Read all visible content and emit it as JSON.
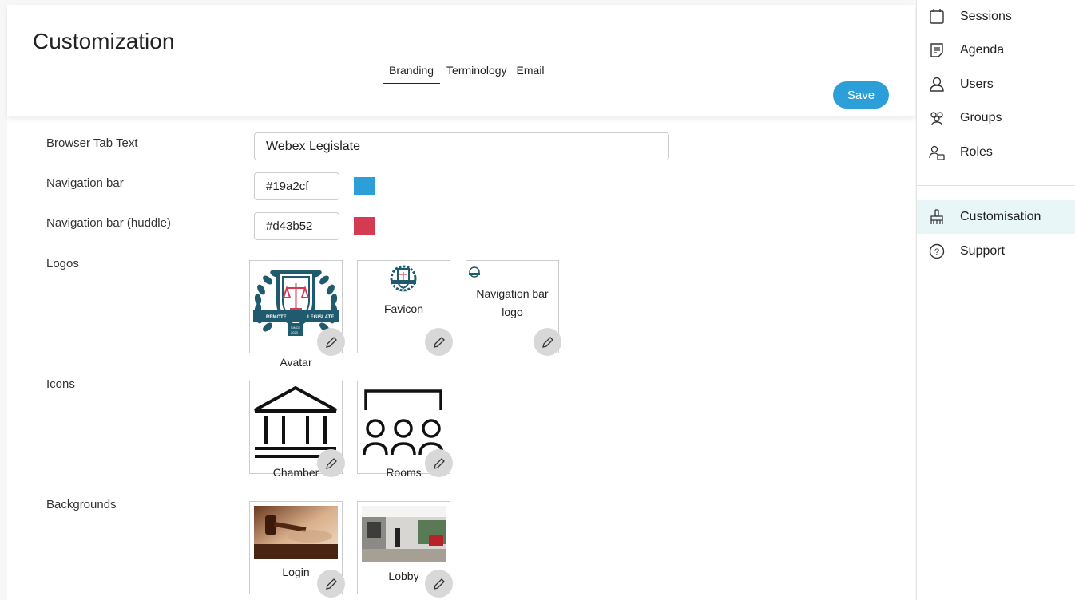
{
  "header": {
    "title": "Customization",
    "tabs": [
      {
        "label": "Branding",
        "active": true
      },
      {
        "label": "Terminology",
        "active": false
      },
      {
        "label": "Email",
        "active": false
      }
    ],
    "save_label": "Save"
  },
  "form": {
    "browser_tab_text": {
      "label": "Browser Tab Text",
      "value": "Webex Legislate"
    },
    "nav_bar": {
      "label": "Navigation bar",
      "value": "#19a2cf",
      "color": "#2d9fd8"
    },
    "nav_bar_huddle": {
      "label": "Navigation bar (huddle)",
      "value": "#d43b52",
      "color": "#d43b52"
    },
    "logos": {
      "label": "Logos",
      "items": [
        {
          "caption": "Avatar",
          "seal_left": "REMOTE",
          "seal_right": "LEGISLATE",
          "seal_since": "SINCE",
          "seal_year": "2020"
        },
        {
          "caption": "Favicon"
        },
        {
          "caption": "Navigation bar logo",
          "caption_line1": "Navigation bar",
          "caption_line2": "logo"
        }
      ]
    },
    "icons": {
      "label": "Icons",
      "items": [
        {
          "caption": "Chamber"
        },
        {
          "caption": "Rooms"
        }
      ]
    },
    "backgrounds": {
      "label": "Backgrounds",
      "items": [
        {
          "caption": "Login"
        },
        {
          "caption": "Lobby"
        }
      ]
    }
  },
  "sidebar": {
    "items": [
      {
        "label": "Sessions",
        "icon": "calendar-icon"
      },
      {
        "label": "Agenda",
        "icon": "agenda-icon"
      },
      {
        "label": "Users",
        "icon": "user-icon"
      },
      {
        "label": "Groups",
        "icon": "groups-icon"
      },
      {
        "label": "Roles",
        "icon": "roles-icon"
      },
      {
        "label": "Customisation",
        "icon": "brush-icon",
        "active": true
      },
      {
        "label": "Support",
        "icon": "help-icon"
      }
    ]
  },
  "colors": {
    "accent": "#2d9fd8",
    "active_bg": "#e8f6f8"
  }
}
